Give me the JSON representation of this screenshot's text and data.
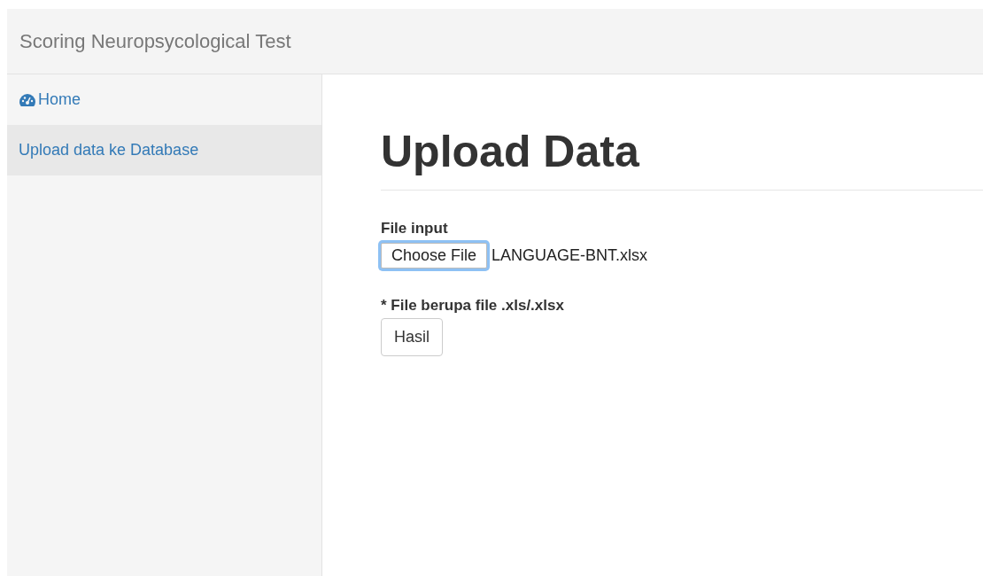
{
  "header": {
    "title": "Scoring Neuropsycological Test"
  },
  "sidebar": {
    "items": [
      {
        "label": "Home",
        "kind": "with-icon",
        "selected": false
      },
      {
        "label": "Upload data ke Database",
        "kind": "plain",
        "selected": true
      }
    ]
  },
  "main": {
    "heading": "Upload Data",
    "file_input": {
      "label": "File input",
      "button": "Choose File",
      "focused": true,
      "value": "LANGUAGE-BNT.xlsx"
    },
    "note": "* File berupa file .xls/.xlsx",
    "submit": "Hasil"
  }
}
